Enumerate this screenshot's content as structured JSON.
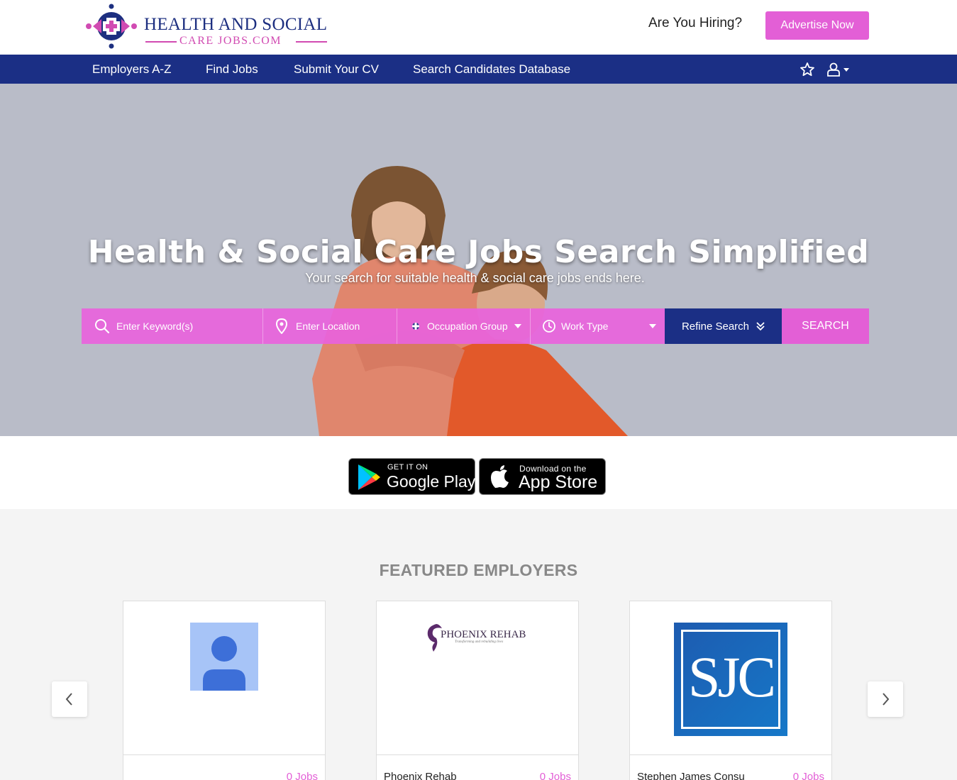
{
  "header": {
    "logo_line1": "HEALTH AND SOCIAL",
    "logo_line2": "CARE JOBS.COM",
    "hiring_text": "Are You Hiring?",
    "advertise_label": "Advertise Now"
  },
  "nav": {
    "items": [
      "Employers A-Z",
      "Find Jobs",
      "Submit Your CV",
      "Search Candidates Database"
    ],
    "icons": [
      "star-icon",
      "user-icon"
    ]
  },
  "hero": {
    "title": "Health & Social Care Jobs Search Simplified",
    "subtitle": "Your search for suitable health & social care jobs ends here."
  },
  "search": {
    "keyword_placeholder": "Enter Keyword(s)",
    "location_placeholder": "Enter Location",
    "occupation_label": "Occupation Group",
    "worktype_label": "Work Type",
    "refine_label": "Refine Search",
    "search_label": "SEARCH"
  },
  "apps": {
    "google_small": "GET IT ON",
    "google_big": "Google Play",
    "apple_small": "Download on the",
    "apple_big": "App Store"
  },
  "featured": {
    "title": "FEATURED EMPLOYERS",
    "employers": [
      {
        "name": "",
        "jobs": "0 Jobs"
      },
      {
        "name": "Phoenix Rehab",
        "jobs": "0 Jobs",
        "logo_text": "PHOENIX REHAB",
        "logo_tagline": "Transforming and rebuilding lives"
      },
      {
        "name": "Stephen James Consu",
        "jobs": "0 Jobs",
        "logo_text": "SJC"
      }
    ]
  },
  "colors": {
    "brand_navy": "#1b2f85",
    "brand_pink": "#e35fd6"
  }
}
